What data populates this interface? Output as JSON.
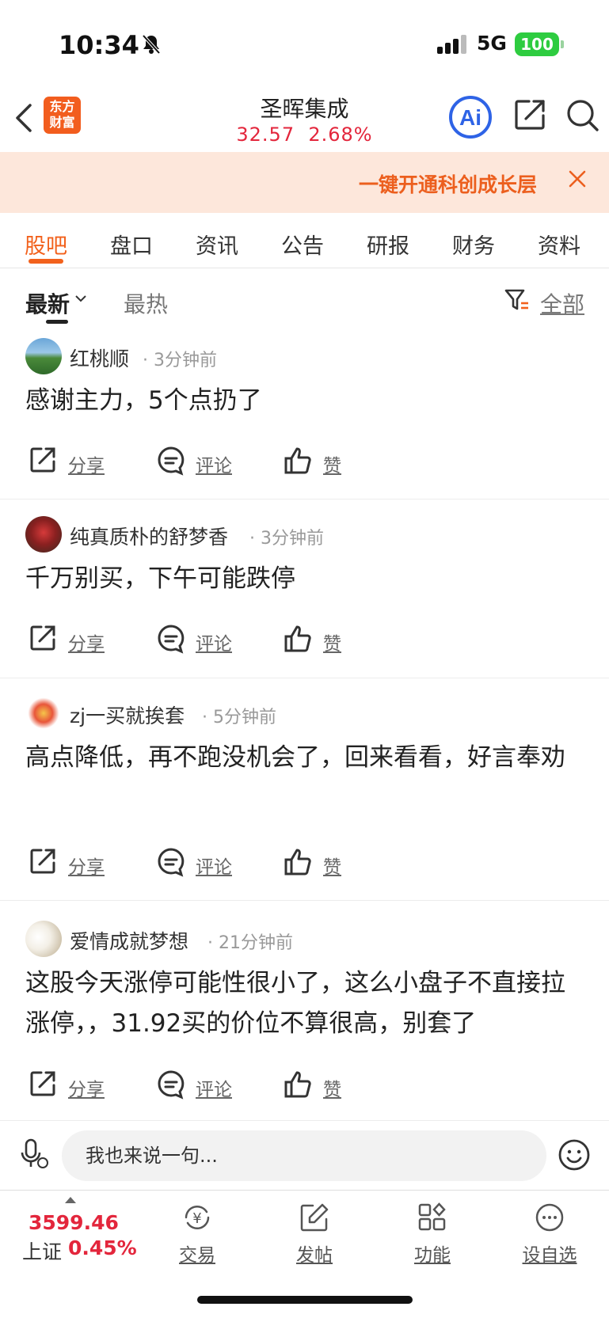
{
  "status_bar": {
    "time": "10:34",
    "network": "5G",
    "battery": "100"
  },
  "nav": {
    "logo_line1": "东方",
    "logo_line2": "财富",
    "stock_name": "圣晖集成",
    "price": "32.57",
    "change_pct": "2.68%"
  },
  "banner": {
    "text": "一键开通科创成长层"
  },
  "tabs": [
    {
      "label": "股吧"
    },
    {
      "label": "盘口"
    },
    {
      "label": "资讯"
    },
    {
      "label": "公告"
    },
    {
      "label": "研报"
    },
    {
      "label": "财务"
    },
    {
      "label": "资料"
    }
  ],
  "sort": {
    "newest": "最新",
    "hottest": "最热",
    "filter_all": "全部"
  },
  "actions": {
    "share": "分享",
    "comment": "评论",
    "like": "赞"
  },
  "posts": [
    {
      "user": "红桃顺",
      "time": "3分钟前",
      "content": "感谢主力，5个点扔了"
    },
    {
      "user": "纯真质朴的舒梦香",
      "time": "3分钟前",
      "content": "千万别买，下午可能跌停"
    },
    {
      "user": "zj一买就挨套",
      "time": "5分钟前",
      "content": "高点降低，再不跑没机会了，回来看看，好言奉劝"
    },
    {
      "user": "爱情成就梦想",
      "time": "21分钟前",
      "content": "这股今天涨停可能性很小了，这么小盘子不直接拉涨停，，31.92买的价位不算很高，别套了"
    }
  ],
  "input": {
    "placeholder": "我也来说一句..."
  },
  "bottom_bar": {
    "index_value": "3599.46",
    "index_name": "上证",
    "index_pct": "0.45%",
    "items": [
      {
        "label": "交易"
      },
      {
        "label": "发帖"
      },
      {
        "label": "功能"
      },
      {
        "label": "设自选"
      }
    ]
  },
  "colors": {
    "accent": "#f2611c",
    "up": "#e3263c",
    "banner_bg": "#fde7db"
  }
}
